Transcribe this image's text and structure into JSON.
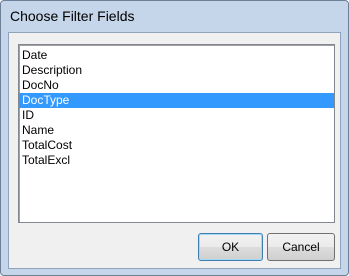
{
  "window": {
    "title": "Choose Filter Fields"
  },
  "field_list": {
    "items": [
      {
        "label": "Date",
        "selected": false
      },
      {
        "label": "Description",
        "selected": false
      },
      {
        "label": "DocNo",
        "selected": false
      },
      {
        "label": "DocType",
        "selected": true
      },
      {
        "label": "ID",
        "selected": false
      },
      {
        "label": "Name",
        "selected": false
      },
      {
        "label": "TotalCost",
        "selected": false
      },
      {
        "label": "TotalExcl",
        "selected": false
      }
    ]
  },
  "buttons": {
    "ok_label": "OK",
    "cancel_label": "Cancel"
  },
  "colors": {
    "frame": "#c6d6ea",
    "selection": "#3399ff",
    "selection_text": "#ffffff"
  }
}
